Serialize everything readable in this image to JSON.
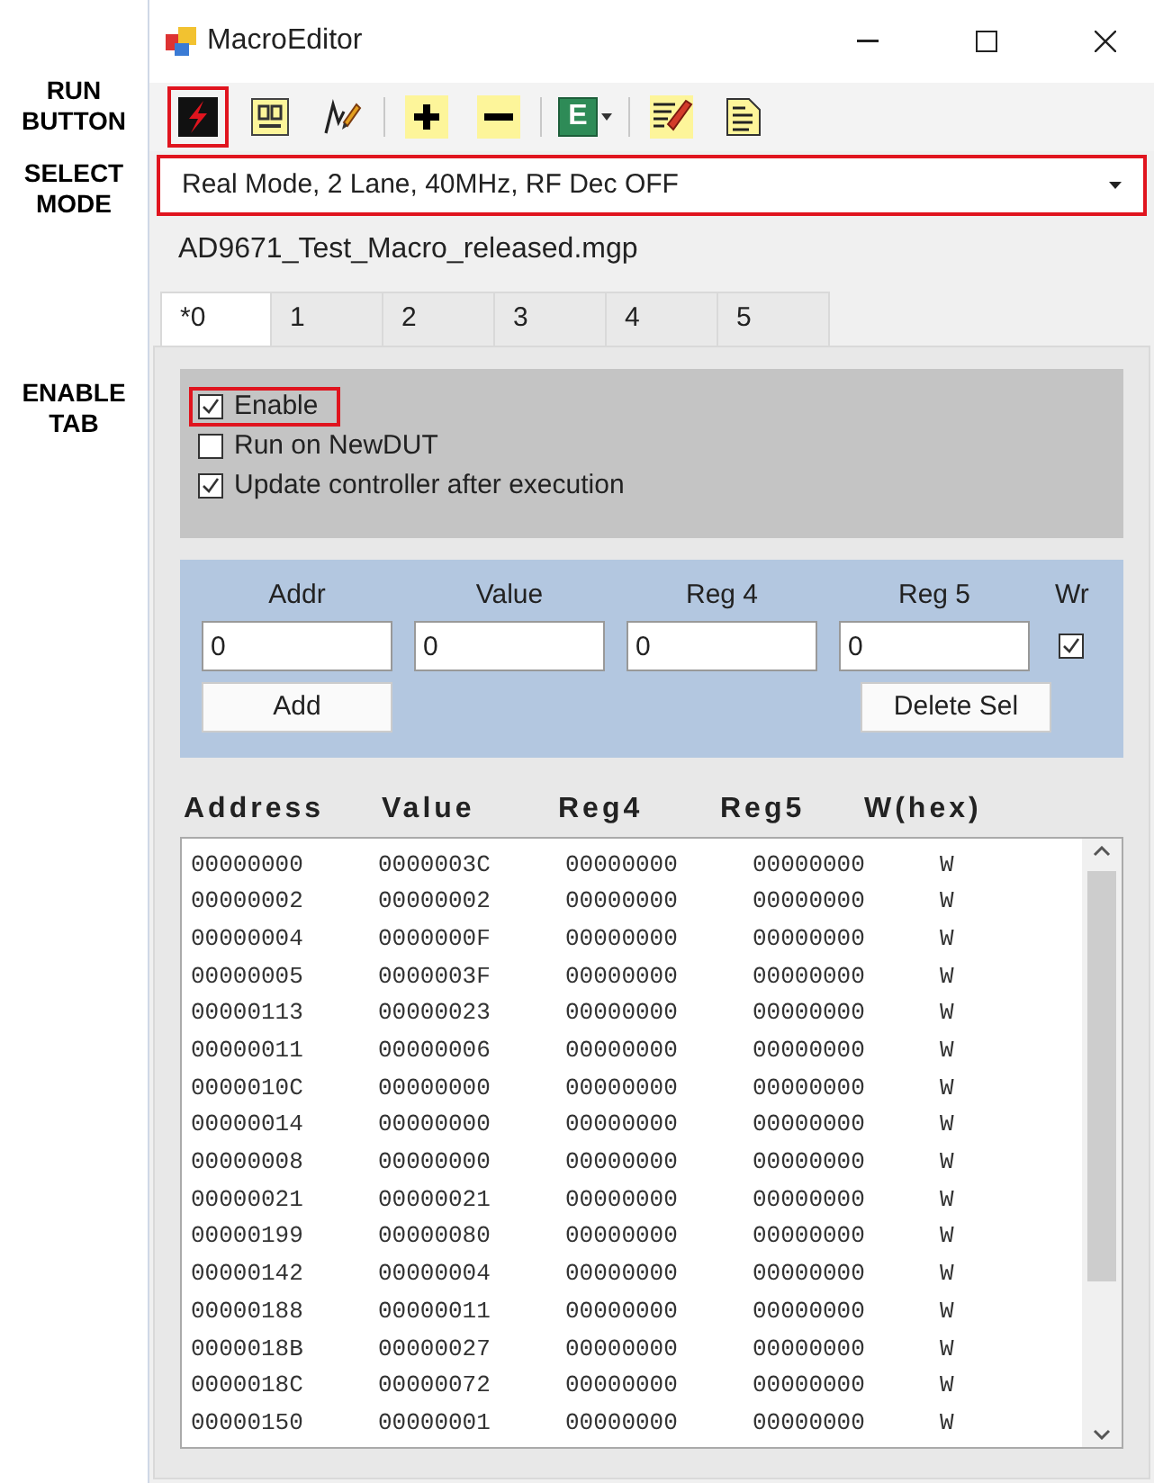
{
  "annotations": [
    {
      "lines": [
        "RUN",
        "BUTTON"
      ]
    },
    {
      "lines": [
        "SELECT",
        "MODE"
      ]
    },
    {
      "lines": [
        "ENABLE",
        "TAB"
      ]
    }
  ],
  "window": {
    "title": "MacroEditor"
  },
  "toolbar": [
    {
      "kind": "run",
      "highlighted": true
    },
    {
      "kind": "grid",
      "highlighted": false
    },
    {
      "kind": "pen",
      "highlighted": false
    },
    {
      "kind": "separator"
    },
    {
      "kind": "plus",
      "highlighted": false
    },
    {
      "kind": "minus",
      "highlighted": false
    },
    {
      "kind": "separator"
    },
    {
      "kind": "letter",
      "label": "E",
      "highlighted": false
    },
    {
      "kind": "separator"
    },
    {
      "kind": "edit",
      "highlighted": false
    },
    {
      "kind": "notes",
      "highlighted": false
    }
  ],
  "mode_select": {
    "value": "Real Mode, 2 Lane, 40MHz, RF Dec OFF",
    "highlighted": true
  },
  "file_name": "AD9671_Test_Macro_released.mgp",
  "tabs": [
    {
      "label": "*0",
      "selected": true
    },
    {
      "label": "1",
      "selected": false
    },
    {
      "label": "2",
      "selected": false
    },
    {
      "label": "3",
      "selected": false
    },
    {
      "label": "4",
      "selected": false
    },
    {
      "label": "5",
      "selected": false
    }
  ],
  "options": [
    {
      "label": "Enable",
      "checked": true,
      "highlighted": true
    },
    {
      "label": "Run on NewDUT",
      "checked": false,
      "highlighted": false
    },
    {
      "label": "Update controller after execution",
      "checked": true,
      "highlighted": false
    }
  ],
  "entry": {
    "fields": [
      {
        "label": "Addr",
        "value": "0"
      },
      {
        "label": "Value",
        "value": "0"
      },
      {
        "label": "Reg 4",
        "value": "0"
      },
      {
        "label": "Reg 5",
        "value": "0"
      }
    ],
    "wr": {
      "label": "Wr",
      "checked": true
    },
    "add_button": "Add",
    "delete_button": "Delete Sel"
  },
  "table": {
    "columns": [
      "Address",
      "Value",
      "Reg4",
      "Reg5",
      "W(hex)"
    ],
    "rows": [
      [
        "00000000",
        "0000003C",
        "00000000",
        "00000000",
        "W"
      ],
      [
        "00000002",
        "00000002",
        "00000000",
        "00000000",
        "W"
      ],
      [
        "00000004",
        "0000000F",
        "00000000",
        "00000000",
        "W"
      ],
      [
        "00000005",
        "0000003F",
        "00000000",
        "00000000",
        "W"
      ],
      [
        "00000113",
        "00000023",
        "00000000",
        "00000000",
        "W"
      ],
      [
        "00000011",
        "00000006",
        "00000000",
        "00000000",
        "W"
      ],
      [
        "0000010C",
        "00000000",
        "00000000",
        "00000000",
        "W"
      ],
      [
        "00000014",
        "00000000",
        "00000000",
        "00000000",
        "W"
      ],
      [
        "00000008",
        "00000000",
        "00000000",
        "00000000",
        "W"
      ],
      [
        "00000021",
        "00000021",
        "00000000",
        "00000000",
        "W"
      ],
      [
        "00000199",
        "00000080",
        "00000000",
        "00000000",
        "W"
      ],
      [
        "00000142",
        "00000004",
        "00000000",
        "00000000",
        "W"
      ],
      [
        "00000188",
        "00000011",
        "00000000",
        "00000000",
        "W"
      ],
      [
        "0000018B",
        "00000027",
        "00000000",
        "00000000",
        "W"
      ],
      [
        "0000018C",
        "00000072",
        "00000000",
        "00000000",
        "W"
      ],
      [
        "00000150",
        "00000001",
        "00000000",
        "00000000",
        "W"
      ]
    ]
  }
}
